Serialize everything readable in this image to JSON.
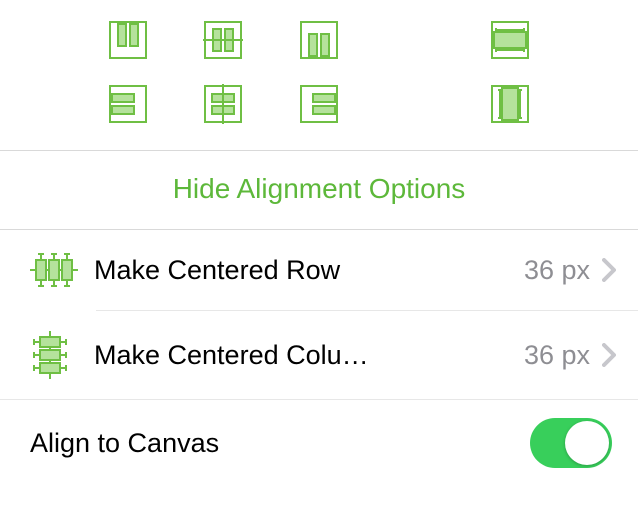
{
  "colors": {
    "accent": "#5db83a",
    "icon_stroke": "#6fbf44",
    "icon_fill": "#b5e29c",
    "divider": "#d9d9d9",
    "toggle_on": "#38cf5b",
    "value_grey": "#8e8e93"
  },
  "alignment_grid": {
    "row1": [
      {
        "name": "align-top-icon",
        "blank": false
      },
      {
        "name": "align-vcenter-icon",
        "blank": false
      },
      {
        "name": "align-bottom-icon",
        "blank": false
      },
      {
        "name": "blank",
        "blank": true
      },
      {
        "name": "stretch-horizontal-icon",
        "blank": false
      }
    ],
    "row2": [
      {
        "name": "align-left-icon",
        "blank": false
      },
      {
        "name": "align-hcenter-icon",
        "blank": false
      },
      {
        "name": "align-right-icon",
        "blank": false
      },
      {
        "name": "blank",
        "blank": true
      },
      {
        "name": "stretch-vertical-icon",
        "blank": false
      }
    ]
  },
  "hide_alignment": {
    "label": "Hide Alignment Options"
  },
  "rows": {
    "centered_row": {
      "label": "Make Centered Row",
      "value": "36 px"
    },
    "centered_column": {
      "label": "Make Centered Colu…",
      "value": "36 px"
    }
  },
  "align_to_canvas": {
    "label": "Align to Canvas",
    "on": true
  }
}
